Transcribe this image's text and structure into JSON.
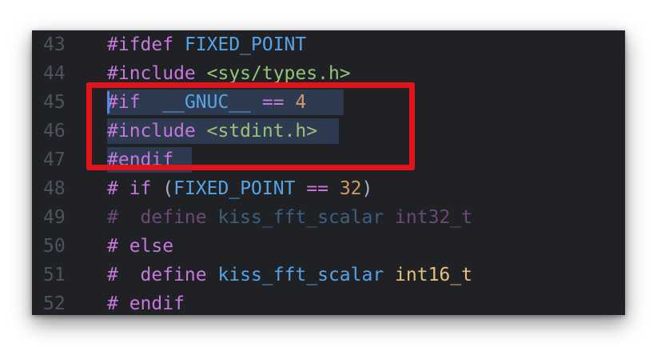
{
  "editor": {
    "lines": [
      {
        "number": "43",
        "tokens": [
          {
            "text": "#ifdef ",
            "color": "#c678dd"
          },
          {
            "text": "FIXED_POINT",
            "color": "#56a4e8"
          }
        ]
      },
      {
        "number": "44",
        "tokens": [
          {
            "text": "#include ",
            "color": "#c678dd"
          },
          {
            "text": "<sys/types.h>",
            "color": "#98c379"
          }
        ]
      },
      {
        "number": "45",
        "selected": true,
        "cursor": true,
        "tokens": [
          {
            "text": "#if  ",
            "color": "#c678dd"
          },
          {
            "text": "__GNUC__ ",
            "color": "#56a4e8"
          },
          {
            "text": "== ",
            "color": "#c678dd"
          },
          {
            "text": "4",
            "color": "#d19a66"
          }
        ]
      },
      {
        "number": "46",
        "selected": true,
        "tokens": [
          {
            "text": "#include ",
            "color": "#c678dd"
          },
          {
            "text": "<stdint.h>",
            "color": "#98c379"
          }
        ]
      },
      {
        "number": "47",
        "selected": true,
        "tokens": [
          {
            "text": "#endif",
            "color": "#c678dd"
          }
        ]
      },
      {
        "number": "48",
        "tokens": [
          {
            "text": "# if ",
            "color": "#c678dd"
          },
          {
            "text": "(",
            "color": "#abb2bf"
          },
          {
            "text": "FIXED_POINT ",
            "color": "#56a4e8"
          },
          {
            "text": "== ",
            "color": "#c678dd"
          },
          {
            "text": "32",
            "color": "#d19a66"
          },
          {
            "text": ")",
            "color": "#abb2bf"
          }
        ]
      },
      {
        "number": "49",
        "dimmed": true,
        "tokens": [
          {
            "text": "#  define ",
            "color": "#6a4a78"
          },
          {
            "text": "kiss_fft_scalar ",
            "color": "#3d5f80"
          },
          {
            "text": "int32_t",
            "color": "#6a4a78"
          }
        ]
      },
      {
        "number": "50",
        "tokens": [
          {
            "text": "# else",
            "color": "#c678dd"
          }
        ]
      },
      {
        "number": "51",
        "tokens": [
          {
            "text": "#  define ",
            "color": "#c678dd"
          },
          {
            "text": "kiss_fft_scalar ",
            "color": "#56a4e8"
          },
          {
            "text": "int16_t",
            "color": "#e5c07b"
          }
        ]
      },
      {
        "number": "52",
        "tokens": [
          {
            "text": "# endif",
            "color": "#c678dd"
          }
        ]
      }
    ]
  },
  "colors": {
    "background": "#1f2125",
    "line_number": "#4e535d",
    "selection": "#2d3a4f",
    "cursor": "#4e8be6",
    "highlight_box": "#e0141b"
  }
}
